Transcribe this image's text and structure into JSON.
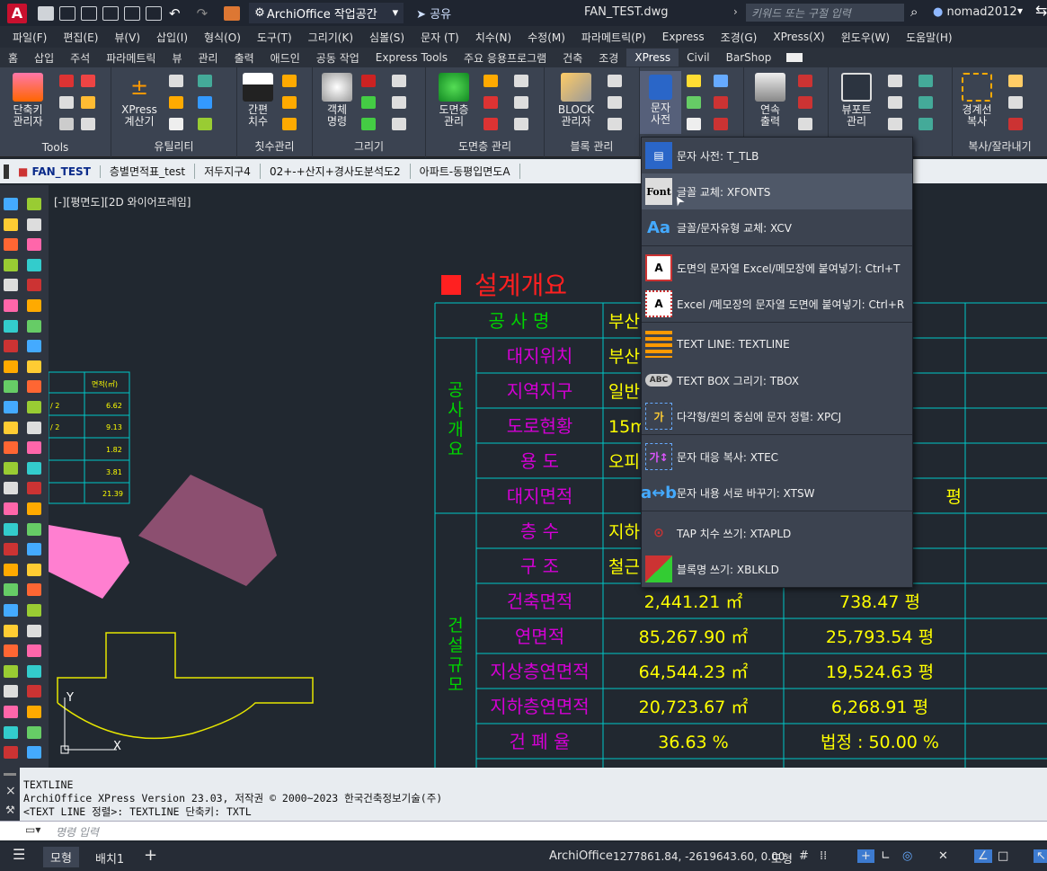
{
  "titlebar": {
    "app_logo": "A",
    "workspace": "ArchiOffice 작업공간",
    "share": "공유",
    "document": "FAN_TEST.dwg",
    "search_placeholder": "키워드 또는 구절 입력",
    "user": "nomad2012"
  },
  "menubar": [
    "파일(F)",
    "편집(E)",
    "뷰(V)",
    "삽입(I)",
    "형식(O)",
    "도구(T)",
    "그리기(K)",
    "심볼(S)",
    "문자 (T)",
    "치수(N)",
    "수정(M)",
    "파라메트릭(P)",
    "Express",
    "조경(G)",
    "XPress(X)",
    "윈도우(W)",
    "도움말(H)"
  ],
  "ribbon_tabs": [
    "홈",
    "삽입",
    "주석",
    "파라메트릭",
    "뷰",
    "관리",
    "출력",
    "애드인",
    "공동 작업",
    "Express Tools",
    "주요 응용프로그램",
    "건축",
    "조경",
    "XPress",
    "Civil",
    "BarShop"
  ],
  "ribbon_active_tab": "XPress",
  "ribbon": {
    "panels": [
      {
        "title": "Tools",
        "buttons": [
          "단축키\n관리자"
        ]
      },
      {
        "title": "유틸리티",
        "buttons": [
          "XPress\n계산기"
        ]
      },
      {
        "title": "칫수관리",
        "buttons": [
          "간편\n치수"
        ]
      },
      {
        "title": "그리기",
        "buttons": [
          "객체\n명령"
        ]
      },
      {
        "title": "도면층 관리",
        "buttons": [
          "도면층\n관리"
        ]
      },
      {
        "title": "블록 관리",
        "buttons": [
          "BLOCK\n관리자"
        ]
      },
      {
        "title": "",
        "buttons": [
          "문자\n사전"
        ]
      },
      {
        "title": "",
        "buttons": [
          "연속\n출력"
        ]
      },
      {
        "title": "",
        "buttons": [
          "뷰포트\n관리"
        ]
      },
      {
        "title": "복사/잘라내기",
        "buttons": [
          "경계선\n복사"
        ]
      }
    ]
  },
  "doc_tabs": [
    "FAN_TEST",
    "층별면적표_test",
    "저두지구4",
    "02+-+산지+경사도분석도2",
    "아파트-동평입면도A"
  ],
  "viewport_label": "[-][평면도][2D 와이어프레임]",
  "dropdown": {
    "items": [
      {
        "icon": "dictionary-icon",
        "label": "문자 사전: T_TLB"
      },
      {
        "icon": "font-replace-icon",
        "label": "글꼴 교체: XFONTS"
      },
      {
        "icon": "font-style-icon",
        "label": "글꼴/문자유형 교체: XCV"
      },
      {
        "icon": "text-to-excel-icon",
        "label": "도면의 문자열 Excel/메모장에 붙여넣기: Ctrl+T"
      },
      {
        "icon": "excel-to-text-icon",
        "label": "Excel /메모장의 문자열 도면에 붙여넣기: Ctrl+R"
      },
      {
        "icon": "text-line-icon",
        "label": "TEXT LINE: TEXTLINE"
      },
      {
        "icon": "text-box-icon",
        "label": "TEXT BOX 그리기: TBOX"
      },
      {
        "icon": "center-text-icon",
        "label": "다각형/원의 중심에 문자 정렬: XPCJ"
      },
      {
        "icon": "copy-text-icon",
        "label": "문자 대응 복사: XTEC"
      },
      {
        "icon": "swap-text-icon",
        "label": "문자 내용 서로 바꾸기: XTSW"
      },
      {
        "icon": "tap-dim-icon",
        "label": "TAP 치수 쓰기: XTAPLD"
      },
      {
        "icon": "block-name-icon",
        "label": "블록명 쓰기: XBLKLD"
      }
    ],
    "hover_index": 1
  },
  "drawing": {
    "heading": "설계개요",
    "group_labels": [
      "공\n사\n개\n요",
      "건\n설\n규\n모"
    ],
    "rows": [
      {
        "label": "공 사 명",
        "value1": "부산",
        "value2": ""
      },
      {
        "label": "대지위치",
        "value1": "부산",
        "value2": ""
      },
      {
        "label": "지역지구",
        "value1": "일반",
        "value2": ""
      },
      {
        "label": "도로현황",
        "value1": "15m",
        "value2": ""
      },
      {
        "label": "용 도",
        "value1": "오피",
        "value2": ""
      },
      {
        "label": "대지면적",
        "value1": "",
        "value2": "평"
      },
      {
        "label": "층 수",
        "value1": "지하",
        "value2": ""
      },
      {
        "label": "구 조",
        "value1": "철근",
        "value2": ""
      },
      {
        "label": "건축면적",
        "value1": "2,441.21 ㎡",
        "value2": "738.47 평"
      },
      {
        "label": "연면적",
        "value1": "85,267.90 ㎡",
        "value2": "25,793.54 평"
      },
      {
        "label": "지상층연면적",
        "value1": "64,544.23 ㎡",
        "value2": "19,524.63 평"
      },
      {
        "label": "지하층연면적",
        "value1": "20,723.67 ㎡",
        "value2": "6,268.91 평"
      },
      {
        "label": "건 폐 율",
        "value1": "36.63 %",
        "value2": "법정 : 50.00 %"
      }
    ],
    "small_table": {
      "header": "면적(㎡)",
      "rows": [
        [
          "/ 2",
          "6.62"
        ],
        [
          "/ 2",
          "9.13"
        ],
        [
          "",
          "1.82"
        ],
        [
          "",
          "3.81"
        ],
        [
          "",
          "21.39"
        ]
      ]
    },
    "axis_y": "Y",
    "axis_x": "X"
  },
  "command": {
    "history": [
      "TEXTLINE",
      "ArchiOffice XPress Version 23.03, 저작권 © 2000~2023 한국건축정보기술(주)",
      "<TEXT LINE 정렬>: TEXTLINE  단축키: TXTL"
    ],
    "placeholder": "명령 입력"
  },
  "status": {
    "tabs": [
      "모형",
      "배치1"
    ],
    "app": "ArchiOffice",
    "coords": "1277861.84, -2619643.60, 0.00",
    "mode": "모형"
  },
  "colors": {
    "background": "#212830",
    "cyan_lines": "#00c8c8",
    "magenta_text": "#d400d4",
    "yellow_text": "#ffff00",
    "green_text": "#00d400",
    "red_heading": "#ff2020",
    "pink_polygon": "#ff7fd0",
    "mauve_polygon": "#8c4f70"
  }
}
